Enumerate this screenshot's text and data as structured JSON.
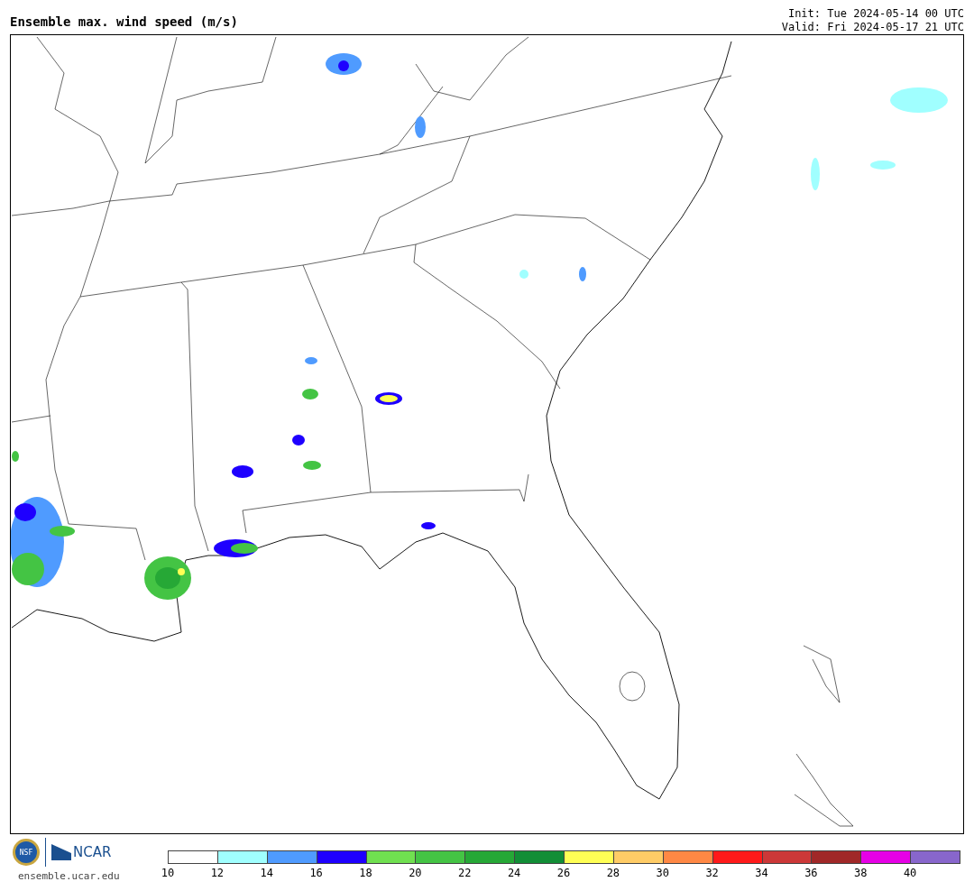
{
  "title": "Ensemble max. wind speed (m/s)",
  "init": "Init: Tue 2024-05-14 00 UTC",
  "valid": "Valid: Fri 2024-05-17 21 UTC",
  "logos": {
    "nsf": "NSF",
    "ncar": "NCAR"
  },
  "site": "ensemble.ucar.edu",
  "colorbar": [
    {
      "label": "10",
      "color": "#ffffff"
    },
    {
      "label": "12",
      "color": "#a0ffff"
    },
    {
      "label": "14",
      "color": "#4f9bff"
    },
    {
      "label": "16",
      "color": "#1e00ff"
    },
    {
      "label": "18",
      "color": "#70e050"
    },
    {
      "label": "20",
      "color": "#44c444"
    },
    {
      "label": "22",
      "color": "#26a836"
    },
    {
      "label": "24",
      "color": "#128e36"
    },
    {
      "label": "26",
      "color": "#ffff55"
    },
    {
      "label": "28",
      "color": "#ffcc66"
    },
    {
      "label": "30",
      "color": "#ff8844"
    },
    {
      "label": "32",
      "color": "#ff1a1a"
    },
    {
      "label": "34",
      "color": "#cc3838"
    },
    {
      "label": "36",
      "color": "#a02828"
    },
    {
      "label": "38",
      "color": "#e600e6"
    },
    {
      "label": "40",
      "color": "#8866cc"
    }
  ]
}
